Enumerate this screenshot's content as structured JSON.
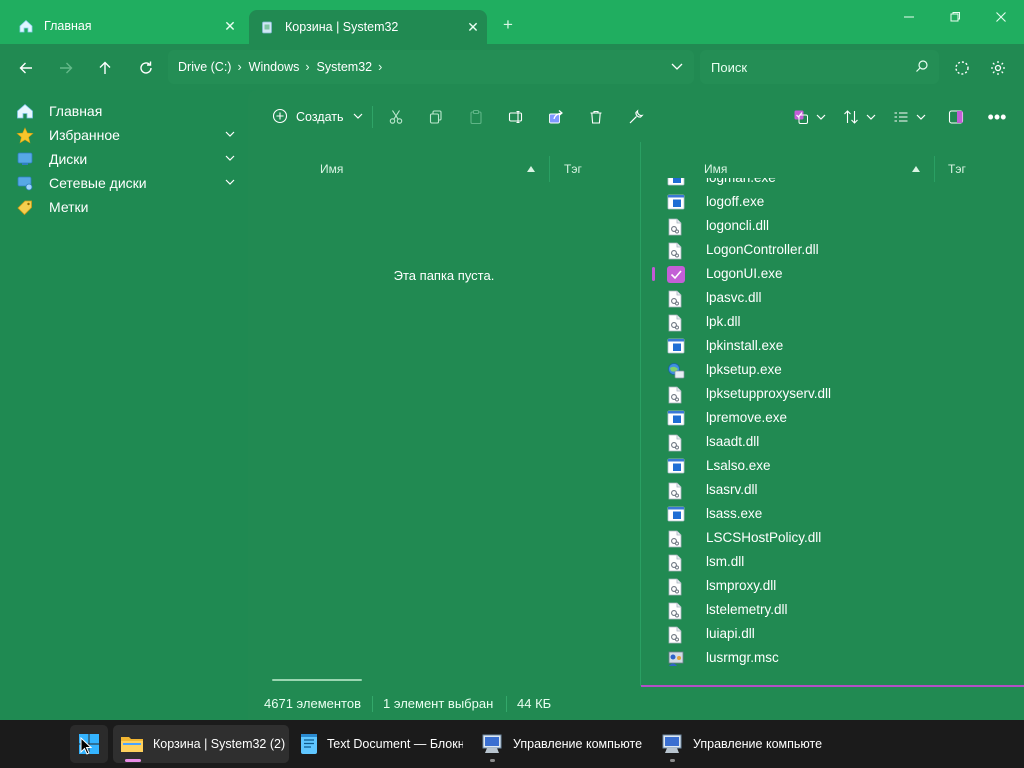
{
  "window": {
    "tabs": [
      {
        "label": "Главная",
        "icon": "home-icon"
      },
      {
        "label": "Корзина | System32",
        "icon": "recycle-bin-icon"
      }
    ],
    "new_tab": "+",
    "controls": {
      "minimize": "—",
      "maximize": "▢",
      "close": "✕"
    }
  },
  "navigation": {
    "breadcrumbs": [
      "Drive (C:)",
      "Windows",
      "System32"
    ],
    "search_placeholder": "Поиск"
  },
  "sidebar": {
    "items": [
      {
        "label": "Главная",
        "icon": "home-icon",
        "expandable": false
      },
      {
        "label": "Избранное",
        "icon": "star-icon",
        "expandable": true
      },
      {
        "label": "Диски",
        "icon": "drive-icon",
        "expandable": true
      },
      {
        "label": "Сетевые диски",
        "icon": "network-drive-icon",
        "expandable": true
      },
      {
        "label": "Метки",
        "icon": "tag-icon",
        "expandable": false
      }
    ]
  },
  "toolbar": {
    "create_label": "Создать"
  },
  "left_pane": {
    "col_name": "Имя",
    "col_tag": "Тэг",
    "empty_message": "Эта папка пуста."
  },
  "right_pane": {
    "col_name": "Имя",
    "col_tag": "Тэг",
    "files": [
      {
        "name": "logman.exe",
        "icon": "exe"
      },
      {
        "name": "logoff.exe",
        "icon": "exe"
      },
      {
        "name": "logoncli.dll",
        "icon": "dll"
      },
      {
        "name": "LogonController.dll",
        "icon": "dll"
      },
      {
        "name": "LogonUI.exe",
        "icon": "exe",
        "selected": true
      },
      {
        "name": "lpasvc.dll",
        "icon": "dll"
      },
      {
        "name": "lpk.dll",
        "icon": "dll"
      },
      {
        "name": "lpkinstall.exe",
        "icon": "exe"
      },
      {
        "name": "lpksetup.exe",
        "icon": "setup"
      },
      {
        "name": "lpksetupproxyserv.dll",
        "icon": "dll"
      },
      {
        "name": "lpremove.exe",
        "icon": "exe"
      },
      {
        "name": "lsaadt.dll",
        "icon": "dll"
      },
      {
        "name": "Lsalso.exe",
        "icon": "exe"
      },
      {
        "name": "lsasrv.dll",
        "icon": "dll"
      },
      {
        "name": "lsass.exe",
        "icon": "exe"
      },
      {
        "name": "LSCSHostPolicy.dll",
        "icon": "dll"
      },
      {
        "name": "lsm.dll",
        "icon": "dll"
      },
      {
        "name": "lsmproxy.dll",
        "icon": "dll"
      },
      {
        "name": "lstelemetry.dll",
        "icon": "dll"
      },
      {
        "name": "luiapi.dll",
        "icon": "dll"
      },
      {
        "name": "lusrmgr.msc",
        "icon": "msc"
      }
    ]
  },
  "status": {
    "count": "4671 элементов",
    "selected": "1 элемент выбран",
    "size": "44 КБ"
  },
  "taskbar": {
    "apps": [
      {
        "label": "Корзина | System32 (2)",
        "icon": "folder-icon"
      },
      {
        "label": "Text Document — Блокн",
        "icon": "notepad-icon"
      },
      {
        "label": "Управление компьюте",
        "icon": "computer-management-icon"
      },
      {
        "label": "Управление компьюте",
        "icon": "computer-management-icon"
      }
    ]
  },
  "colors": {
    "accent": "#20ae60",
    "background": "#218a52",
    "selection": "#c35fd6",
    "taskbar": "#1b1b1b"
  }
}
